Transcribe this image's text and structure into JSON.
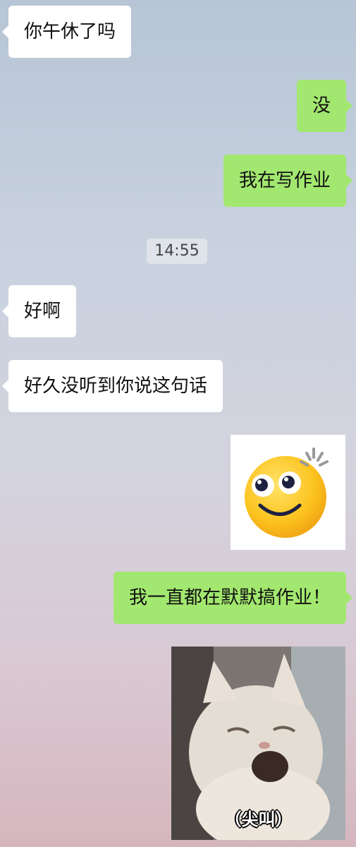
{
  "messages": {
    "m1": "你午休了吗",
    "m2": "没",
    "m3": "我在写作业",
    "m4": "好啊",
    "m5": "好久没听到你说这句话",
    "m6": "我一直都在默默搞作业！"
  },
  "timestamp": "14:55",
  "stickers": {
    "emoji": "smiling-face-sticker",
    "cat": {
      "caption": "（尖叫）"
    }
  },
  "colors": {
    "incoming_bubble": "#ffffff",
    "outgoing_bubble": "#a2e76f"
  }
}
